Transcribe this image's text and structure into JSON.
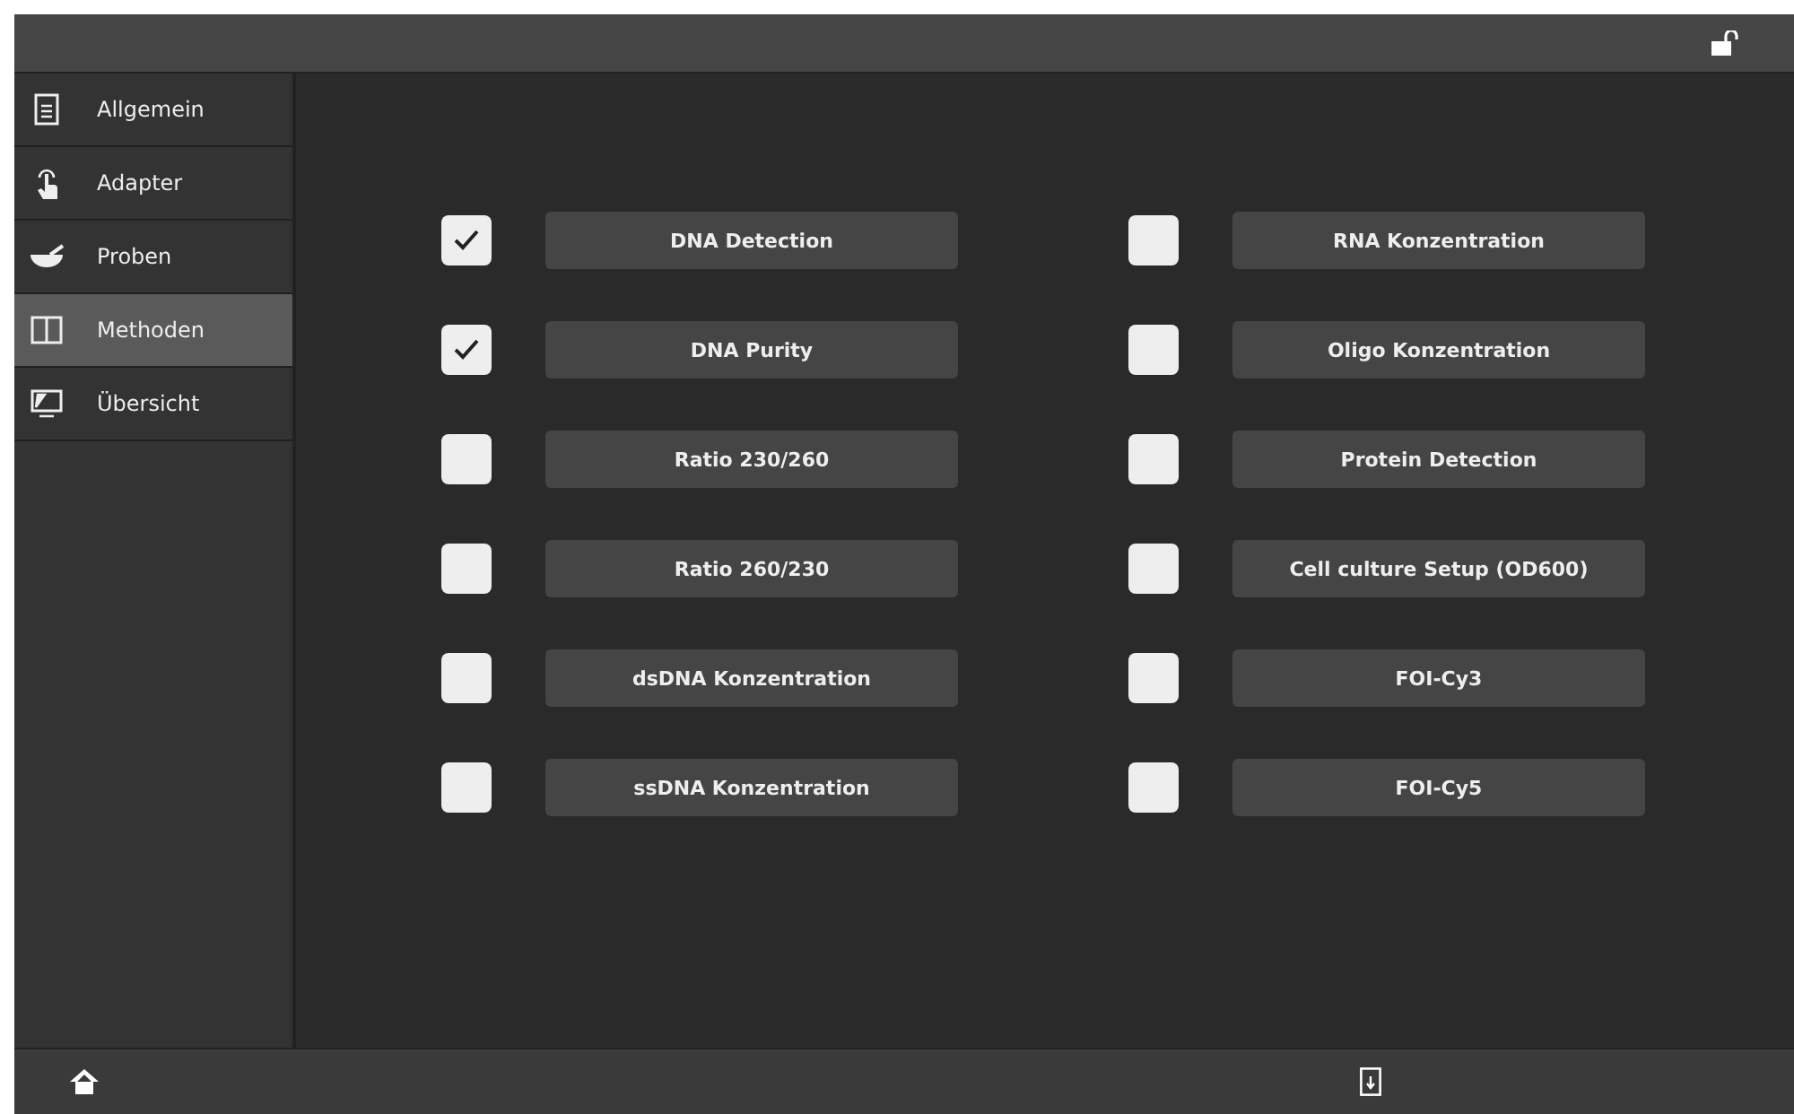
{
  "sidebar": {
    "items": [
      {
        "label": "Allgemein",
        "kind": "document",
        "selected": false
      },
      {
        "label": "Adapter",
        "kind": "touch",
        "selected": false
      },
      {
        "label": "Proben",
        "kind": "bowl",
        "selected": false
      },
      {
        "label": "Methoden",
        "kind": "book",
        "selected": true
      },
      {
        "label": "Übersicht",
        "kind": "monitor",
        "selected": false
      }
    ]
  },
  "methods": {
    "columns": [
      [
        {
          "label": "DNA Detection",
          "checked": true
        },
        {
          "label": "DNA Purity",
          "checked": true
        },
        {
          "label": "Ratio 230/260",
          "checked": false
        },
        {
          "label": "Ratio 260/230",
          "checked": false
        },
        {
          "label": "dsDNA Konzentration",
          "checked": false
        },
        {
          "label": "ssDNA Konzentration",
          "checked": false
        }
      ],
      [
        {
          "label": "RNA Konzentration",
          "checked": false
        },
        {
          "label": "Oligo Konzentration",
          "checked": false
        },
        {
          "label": "Protein Detection",
          "checked": false
        },
        {
          "label": "Cell culture Setup (OD600)",
          "checked": false
        },
        {
          "label": "FOI-Cy3",
          "checked": false
        },
        {
          "label": "FOI-Cy5",
          "checked": false
        }
      ]
    ]
  }
}
